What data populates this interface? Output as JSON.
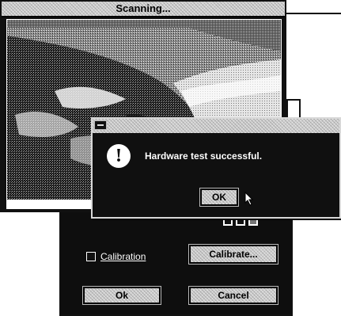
{
  "scanning_window": {
    "title": "Scanning...",
    "image_label": "scanned-coastline-photo"
  },
  "alert_dialog": {
    "message": "Hardware test successful.",
    "ok_label": "OK",
    "icon": "exclamation-icon"
  },
  "main_dialog": {
    "calibration_label": "Calibration",
    "calibrate_label": "Calibrate...",
    "ok_label": "Ok",
    "cancel_label": "Cancel"
  },
  "colors": {
    "window_dark": "#0e0e0e",
    "text_light": "#ffffff",
    "button_face": "#cfcfcf"
  }
}
